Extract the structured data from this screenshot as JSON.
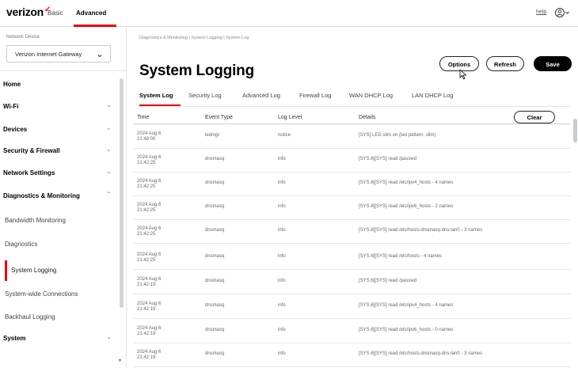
{
  "header": {
    "logo": "verizon",
    "logo_mark": "✓",
    "tabs": [
      {
        "label": "Basic"
      },
      {
        "label": "Advanced"
      }
    ],
    "link": "help",
    "user_icon": "user-circle-icon"
  },
  "sidebar": {
    "network_label": "Network Device",
    "network_value": "Verizon Internet Gateway",
    "items": [
      {
        "label": "Home"
      },
      {
        "label": "Wi-Fi"
      },
      {
        "label": "Devices"
      },
      {
        "label": "Security & Firewall"
      },
      {
        "label": "Network Settings"
      },
      {
        "label": "Diagnostics & Monitoring"
      },
      {
        "label": "Bandwidth Monitoring"
      },
      {
        "label": "Diagnostics"
      },
      {
        "label": "System Logging"
      },
      {
        "label": "System-wide Connections"
      },
      {
        "label": "Backhaul Logging"
      },
      {
        "label": "System"
      }
    ]
  },
  "main": {
    "breadcrumb": "Diagnostics & Monitoring  |  System Logging  |  System Log",
    "title": "System Logging",
    "buttons": {
      "options": "Options",
      "refresh": "Refresh",
      "save": "Save",
      "clear": "Clear"
    },
    "log_tabs": [
      "System Log",
      "Security Log",
      "Advanced Log",
      "Firewall Log",
      "WAN DHCP Log",
      "LAN DHCP Log"
    ],
    "columns": [
      "Time",
      "Event Type",
      "Log Level",
      "Details"
    ],
    "rows": [
      {
        "time": "2024 Aug 6\n21:48:00",
        "event": "ledmgr",
        "level": "notice",
        "details": "[SYS] LED slim on (led pattern: slim)"
      },
      {
        "time": "2024 Aug 6\n21:42:25",
        "event": "dnsmasq",
        "level": "info",
        "details": "[SYS.6][SYS] read /passwd"
      },
      {
        "time": "2024 Aug 6\n21:42:25",
        "event": "dnsmasq",
        "level": "info",
        "details": "[SYS.6][SYS] read /etc/ipv4_hosts - 4 names"
      },
      {
        "time": "2024 Aug 6\n21:42:25",
        "event": "dnsmasq",
        "level": "info",
        "details": "[SYS.6][SYS] read /etc/ipv6_hosts - 2 names"
      },
      {
        "time": "2024 Aug 6\n21:42:25",
        "event": "dnsmasq",
        "level": "info",
        "details": "[SYS.6][SYS] read /etc/hosts.dnsmasq-dns-lan0 - 3 names"
      },
      {
        "time": "2024 Aug 6\n21:42:25",
        "event": "dnsmasq",
        "level": "info",
        "details": "[SYS.6][SYS] read /etc/hosts - 4 names"
      },
      {
        "time": "2024 Aug 6\n21:42:19",
        "event": "dnsmasq",
        "level": "info",
        "details": "[SYS.6][SYS] read /passwd"
      },
      {
        "time": "2024 Aug 6\n21:42:19",
        "event": "dnsmasq",
        "level": "info",
        "details": "[SYS.6][SYS] read /etc/ipv4_hosts - 4 names"
      },
      {
        "time": "2024 Aug 6\n21:42:19",
        "event": "dnsmasq",
        "level": "info",
        "details": "[SYS.6][SYS] read /etc/ipv6_hosts - 0 names"
      },
      {
        "time": "2024 Aug 6\n21:42:19",
        "event": "dnsmasq",
        "level": "info",
        "details": "[SYS.6][SYS] read /etc/hosts.dnsmasq-dns-lan0 - 3 names"
      }
    ]
  },
  "colors": {
    "accent": "#ee0000",
    "primary_button": "#000000"
  }
}
